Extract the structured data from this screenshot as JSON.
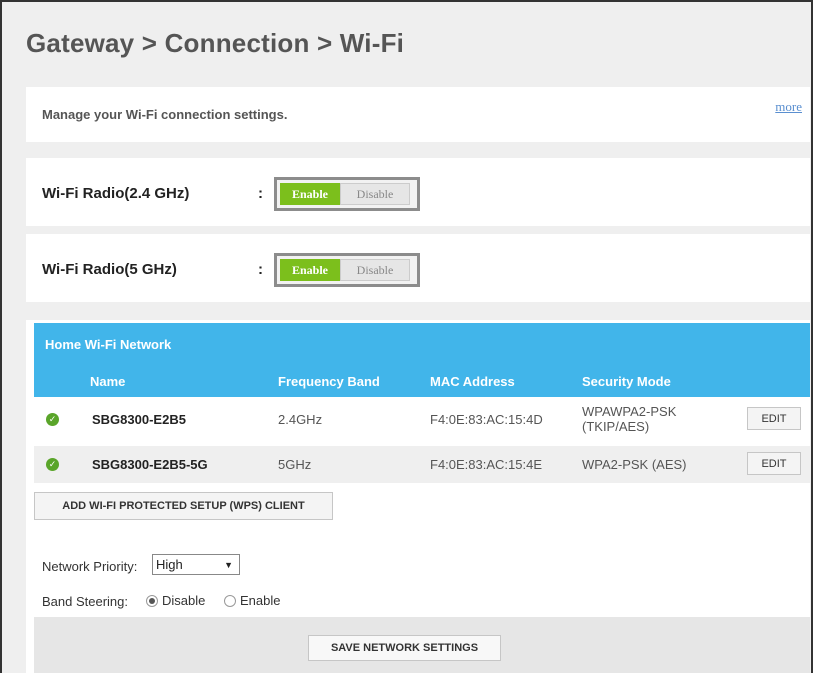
{
  "page": {
    "title": "Gateway > Connection > Wi-Fi"
  },
  "description": {
    "text": "Manage your Wi-Fi connection settings.",
    "more_link": "more"
  },
  "radios": [
    {
      "label": "Wi-Fi Radio(2.4 GHz)",
      "colon": ":",
      "enable": "Enable",
      "disable": "Disable",
      "state": "enabled"
    },
    {
      "label": "Wi-Fi Radio(5 GHz)",
      "colon": ":",
      "enable": "Enable",
      "disable": "Disable",
      "state": "enabled"
    }
  ],
  "network": {
    "title": "Home Wi-Fi Network",
    "columns": {
      "name": "Name",
      "band": "Frequency Band",
      "mac": "MAC Address",
      "security": "Security Mode"
    },
    "rows": [
      {
        "name": "SBG8300-E2B5",
        "band": "2.4GHz",
        "mac": "F4:0E:83:AC:15:4D",
        "security_line1": "WPAWPA2-PSK",
        "security_line2": "(TKIP/AES)",
        "edit": "EDIT",
        "status_icon": "check-circle-icon"
      },
      {
        "name": "SBG8300-E2B5-5G",
        "band": "5GHz",
        "mac": "F4:0E:83:AC:15:4E",
        "security_line1": "WPA2-PSK (AES)",
        "security_line2": "",
        "edit": "EDIT",
        "status_icon": "check-circle-icon"
      }
    ],
    "wps_button": "ADD WI-FI PROTECTED SETUP (WPS) CLIENT",
    "priority": {
      "label": "Network Priority:",
      "selected": "High"
    },
    "band_steering": {
      "label": "Band Steering:",
      "options": [
        "Disable",
        "Enable"
      ],
      "selected": "Disable"
    },
    "save_button": "SAVE NETWORK SETTINGS"
  },
  "colors": {
    "accent_blue": "#41b5ea",
    "enable_green": "#7cbf1c",
    "check_green": "#5aa52a",
    "link_blue": "#5a8fd0"
  }
}
